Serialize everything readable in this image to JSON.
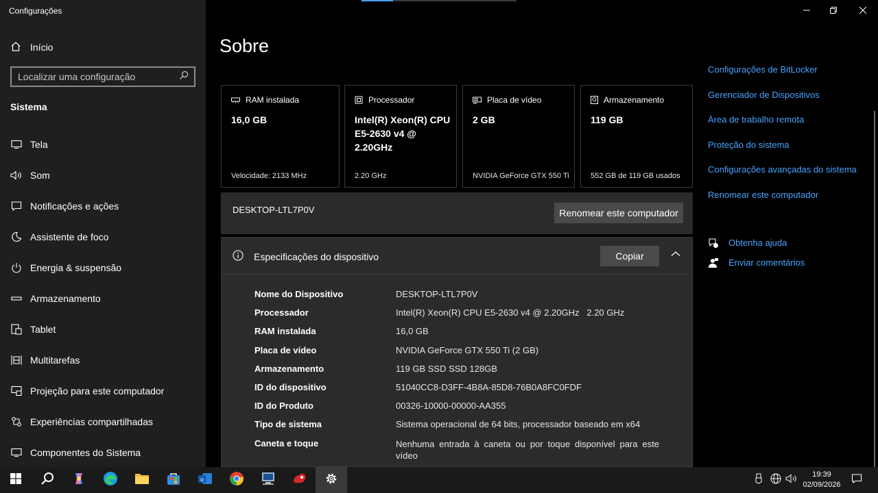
{
  "app": {
    "title": "Configurações"
  },
  "sidebar": {
    "home_label": "Início",
    "search_placeholder": "Localizar uma configuração",
    "section": "Sistema",
    "items": [
      {
        "label": "Tela",
        "icon": "monitor-icon"
      },
      {
        "label": "Som",
        "icon": "speaker-icon"
      },
      {
        "label": "Notificações e ações",
        "icon": "notification-icon"
      },
      {
        "label": "Assistente de foco",
        "icon": "moon-icon"
      },
      {
        "label": "Energia & suspensão",
        "icon": "power-icon"
      },
      {
        "label": "Armazenamento",
        "icon": "storage-icon"
      },
      {
        "label": "Tablet",
        "icon": "tablet-icon"
      },
      {
        "label": "Multitarefas",
        "icon": "multitask-icon"
      },
      {
        "label": "Projeção para este computador",
        "icon": "projection-icon"
      },
      {
        "label": "Experiências compartilhadas",
        "icon": "shared-icon"
      },
      {
        "label": "Componentes do Sistema",
        "icon": "components-icon"
      }
    ]
  },
  "main": {
    "title": "Sobre",
    "cards": [
      {
        "label": "RAM instalada",
        "value": "16,0 GB",
        "sub": "Velocidade: 2133 MHz",
        "icon": "ram-icon"
      },
      {
        "label": "Processador",
        "value": "Intel(R) Xeon(R) CPU E5-2630 v4 @ 2.20GHz",
        "sub": "2.20 GHz",
        "icon": "cpu-icon"
      },
      {
        "label": "Placa de vídeo",
        "value": "2 GB",
        "sub": "NVIDIA GeForce GTX 550 Ti",
        "icon": "gpu-icon"
      },
      {
        "label": "Armazenamento",
        "value": "119 GB",
        "sub": "552 GB de 119 GB usados",
        "icon": "disk-icon"
      }
    ],
    "device_name": "DESKTOP-LTL7P0V",
    "rename_label": "Renomear este computador",
    "specs": {
      "title": "Especificações do dispositivo",
      "copy_label": "Copiar",
      "rows": [
        {
          "key": "Nome do Dispositivo",
          "value": "DESKTOP-LTL7P0V"
        },
        {
          "key": "Processador",
          "value": "Intel(R) Xeon(R) CPU E5-2630 v4 @ 2.20GHz   2.20 GHz"
        },
        {
          "key": "RAM instalada",
          "value": "16,0 GB"
        },
        {
          "key": "Placa de vídeo",
          "value": "NVIDIA GeForce GTX 550 Ti (2 GB)"
        },
        {
          "key": "Armazenamento",
          "value": "119 GB SSD SSD 128GB"
        },
        {
          "key": "ID do dispositivo",
          "value": "51040CC8-D3FF-4B8A-85D8-76B0A8FC0FDF"
        },
        {
          "key": "ID do Produto",
          "value": "00326-10000-00000-AA355"
        },
        {
          "key": "Tipo de sistema",
          "value": "Sistema operacional de 64 bits, processador baseado em x64"
        },
        {
          "key": "Caneta e toque",
          "value": "Nenhuma entrada à caneta ou por toque disponível para este vídeo"
        }
      ]
    }
  },
  "related_links": [
    "Configurações de BitLocker",
    "Gerenciador de Dispositivos",
    "Área de trabalho remota",
    "Proteção do sistema",
    "Configurações avançadas do sistema",
    "Renomear este computador"
  ],
  "help": {
    "get_help": "Obtenha ajuda",
    "feedback": "Enviar comentários"
  },
  "taskbar": {
    "time": "19:39",
    "date": "02/09/2026"
  },
  "colors": {
    "accent": "#4aa3ff",
    "sidebar_bg": "#1f1f1f",
    "panel_bg": "#2b2b2b"
  }
}
